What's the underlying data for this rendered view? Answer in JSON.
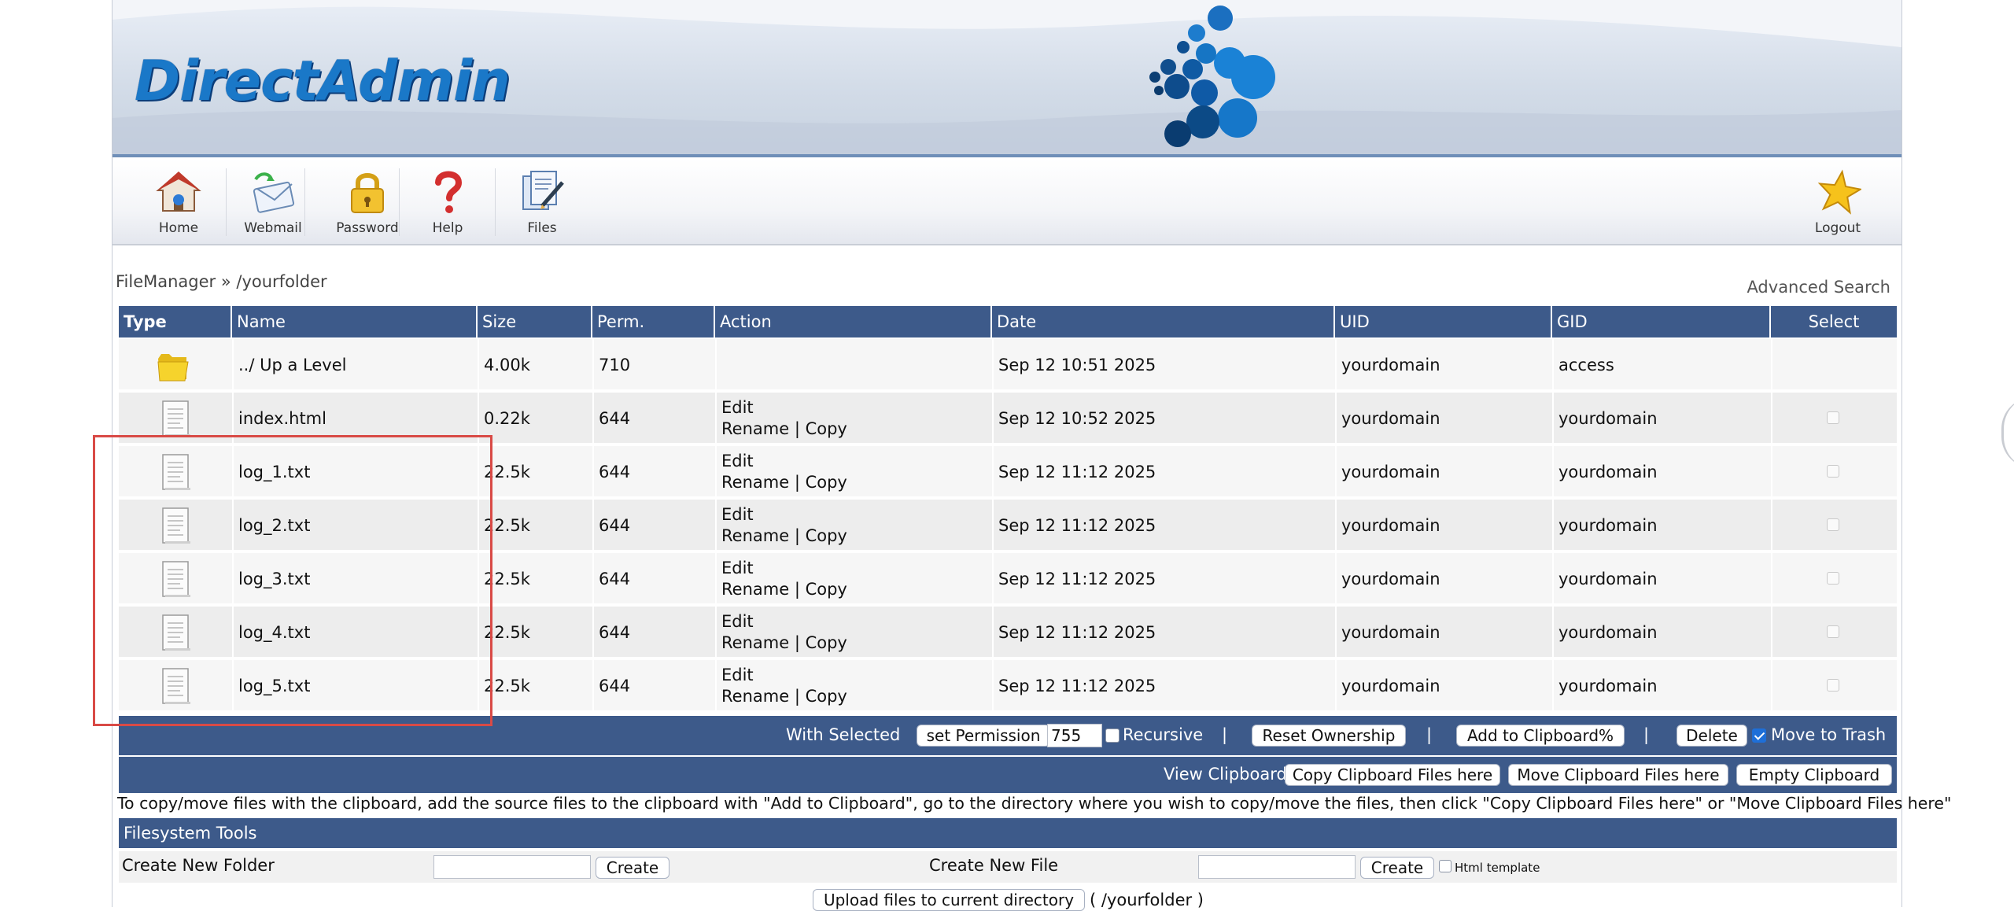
{
  "brand": {
    "logo_text": "DirectAdmin"
  },
  "toolbar": {
    "items": [
      {
        "label": "Home",
        "icon": "house-icon"
      },
      {
        "label": "Webmail",
        "icon": "mail-icon"
      },
      {
        "label": "Password",
        "icon": "padlock-icon"
      },
      {
        "label": "Help",
        "icon": "question-mark-icon"
      },
      {
        "label": "Files",
        "icon": "documents-icon"
      }
    ],
    "logout_label": "Logout"
  },
  "breadcrumb": "FileManager » /yourfolder",
  "advanced_search": "Advanced Search",
  "table": {
    "headers": {
      "type": "Type",
      "name": "Name",
      "size": "Size",
      "perm": "Perm.",
      "action": "Action",
      "date": "Date",
      "uid": "UID",
      "gid": "GID",
      "select": "Select"
    },
    "rows": [
      {
        "kind": "folder",
        "name": "../ Up a Level",
        "size": "4.00k",
        "perm": "710",
        "date": "Sep 12 10:51 2025",
        "uid": "yourdomain",
        "gid": "access",
        "edit": "",
        "rename": "",
        "sep": "",
        "copy": ""
      },
      {
        "kind": "file",
        "name": "index.html",
        "size": "0.22k",
        "perm": "644",
        "date": "Sep 12 10:52 2025",
        "uid": "yourdomain",
        "gid": "yourdomain",
        "edit": "Edit",
        "rename": "Rename",
        "sep": "|",
        "copy": "Copy"
      },
      {
        "kind": "file",
        "name": "log_1.txt",
        "size": "22.5k",
        "perm": "644",
        "date": "Sep 12 11:12 2025",
        "uid": "yourdomain",
        "gid": "yourdomain",
        "edit": "Edit",
        "rename": "Rename",
        "sep": "|",
        "copy": "Copy"
      },
      {
        "kind": "file",
        "name": "log_2.txt",
        "size": "22.5k",
        "perm": "644",
        "date": "Sep 12 11:12 2025",
        "uid": "yourdomain",
        "gid": "yourdomain",
        "edit": "Edit",
        "rename": "Rename",
        "sep": "|",
        "copy": "Copy"
      },
      {
        "kind": "file",
        "name": "log_3.txt",
        "size": "22.5k",
        "perm": "644",
        "date": "Sep 12 11:12 2025",
        "uid": "yourdomain",
        "gid": "yourdomain",
        "edit": "Edit",
        "rename": "Rename",
        "sep": "|",
        "copy": "Copy"
      },
      {
        "kind": "file",
        "name": "log_4.txt",
        "size": "22.5k",
        "perm": "644",
        "date": "Sep 12 11:12 2025",
        "uid": "yourdomain",
        "gid": "yourdomain",
        "edit": "Edit",
        "rename": "Rename",
        "sep": "|",
        "copy": "Copy"
      },
      {
        "kind": "file",
        "name": "log_5.txt",
        "size": "22.5k",
        "perm": "644",
        "date": "Sep 12 11:12 2025",
        "uid": "yourdomain",
        "gid": "yourdomain",
        "edit": "Edit",
        "rename": "Rename",
        "sep": "|",
        "copy": "Copy"
      }
    ]
  },
  "selected_bar": {
    "label": "With Selected",
    "set_permission": "set Permission",
    "permission_value": "755",
    "recursive_label": "Recursive",
    "sep": "|",
    "reset_ownership": "Reset Ownership",
    "add_clipboard": "Add to Clipboard%",
    "delete": "Delete",
    "move_to_trash_label": "Move to Trash",
    "move_to_trash_checked": true
  },
  "clipboard_bar": {
    "view": "View Clipboard",
    "copy_here": "Copy Clipboard Files here",
    "move_here": "Move Clipboard Files here",
    "empty": "Empty Clipboard"
  },
  "info_text": "To copy/move files with the clipboard, add the source files to the clipboard with \"Add to Clipboard\", go to the directory where you wish to copy/move the files, then click \"Copy Clipboard Files here\" or \"Move Clipboard Files here\"",
  "filesystem_tools": {
    "title": "Filesystem Tools",
    "new_folder_label": "Create New Folder",
    "new_file_label": "Create New File",
    "create": "Create",
    "html_template": "Html template",
    "upload": "Upload files to current directory",
    "upload_path": "( /yourfolder )"
  },
  "colors": {
    "header_bg": "#3d5a8a",
    "highlight": "#d94a46",
    "logo": "#1a78c8"
  }
}
